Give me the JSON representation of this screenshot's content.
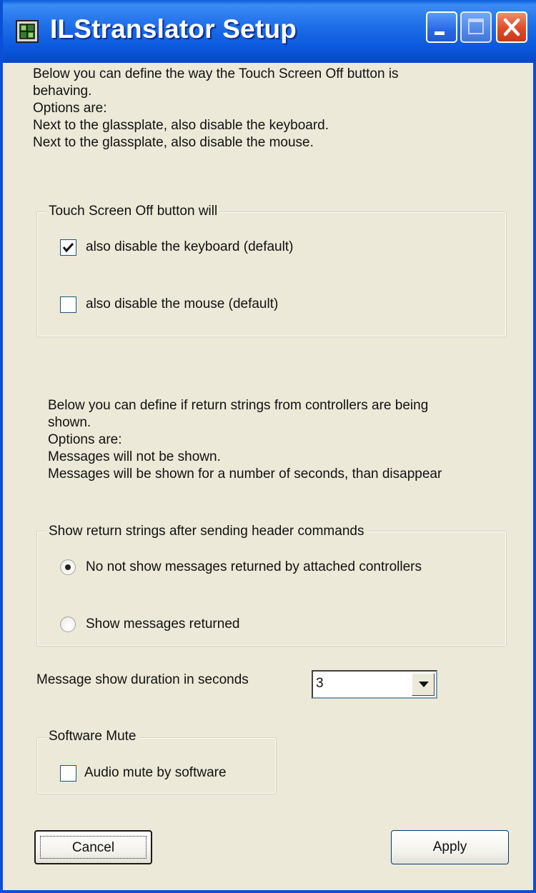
{
  "window": {
    "title": "ILStranslator Setup",
    "title_color": "#ffffff",
    "titlebar_color": "#0b58dd"
  },
  "titlebar_buttons": {
    "minimize_icon": "minimize-icon",
    "maximize_icon": "maximize-icon",
    "close_icon": "close-icon"
  },
  "intro_touch": {
    "text": "Below you can define the way the Touch Screen Off button is\nbehaving.\nOptions are:\nNext to the glassplate, also disable the keyboard.\nNext to the glassplate, also disable the mouse."
  },
  "touch_group": {
    "legend": "Touch Screen Off button will",
    "keyboard_label": "also disable the keyboard (default)",
    "keyboard_checked": true,
    "mouse_label": "also disable the mouse (default)",
    "mouse_checked": false
  },
  "intro_return": {
    "text": "Below you can define if return strings from controllers are being\nshown.\nOptions are:\nMessages will not be shown.\nMessages will be shown for a number of seconds, than disappear"
  },
  "return_group": {
    "legend": "Show return strings after sending header commands",
    "option_no_show": "No not show messages returned by attached controllers",
    "option_show": "Show messages returned",
    "selected": "option_no_show"
  },
  "duration": {
    "label": "Message show duration in seconds",
    "value": "3"
  },
  "mute_group": {
    "legend": "Software Mute",
    "checkbox_label": "Audio mute by software",
    "checked": false
  },
  "buttons": {
    "cancel_label": "Cancel",
    "apply_label": "Apply"
  }
}
